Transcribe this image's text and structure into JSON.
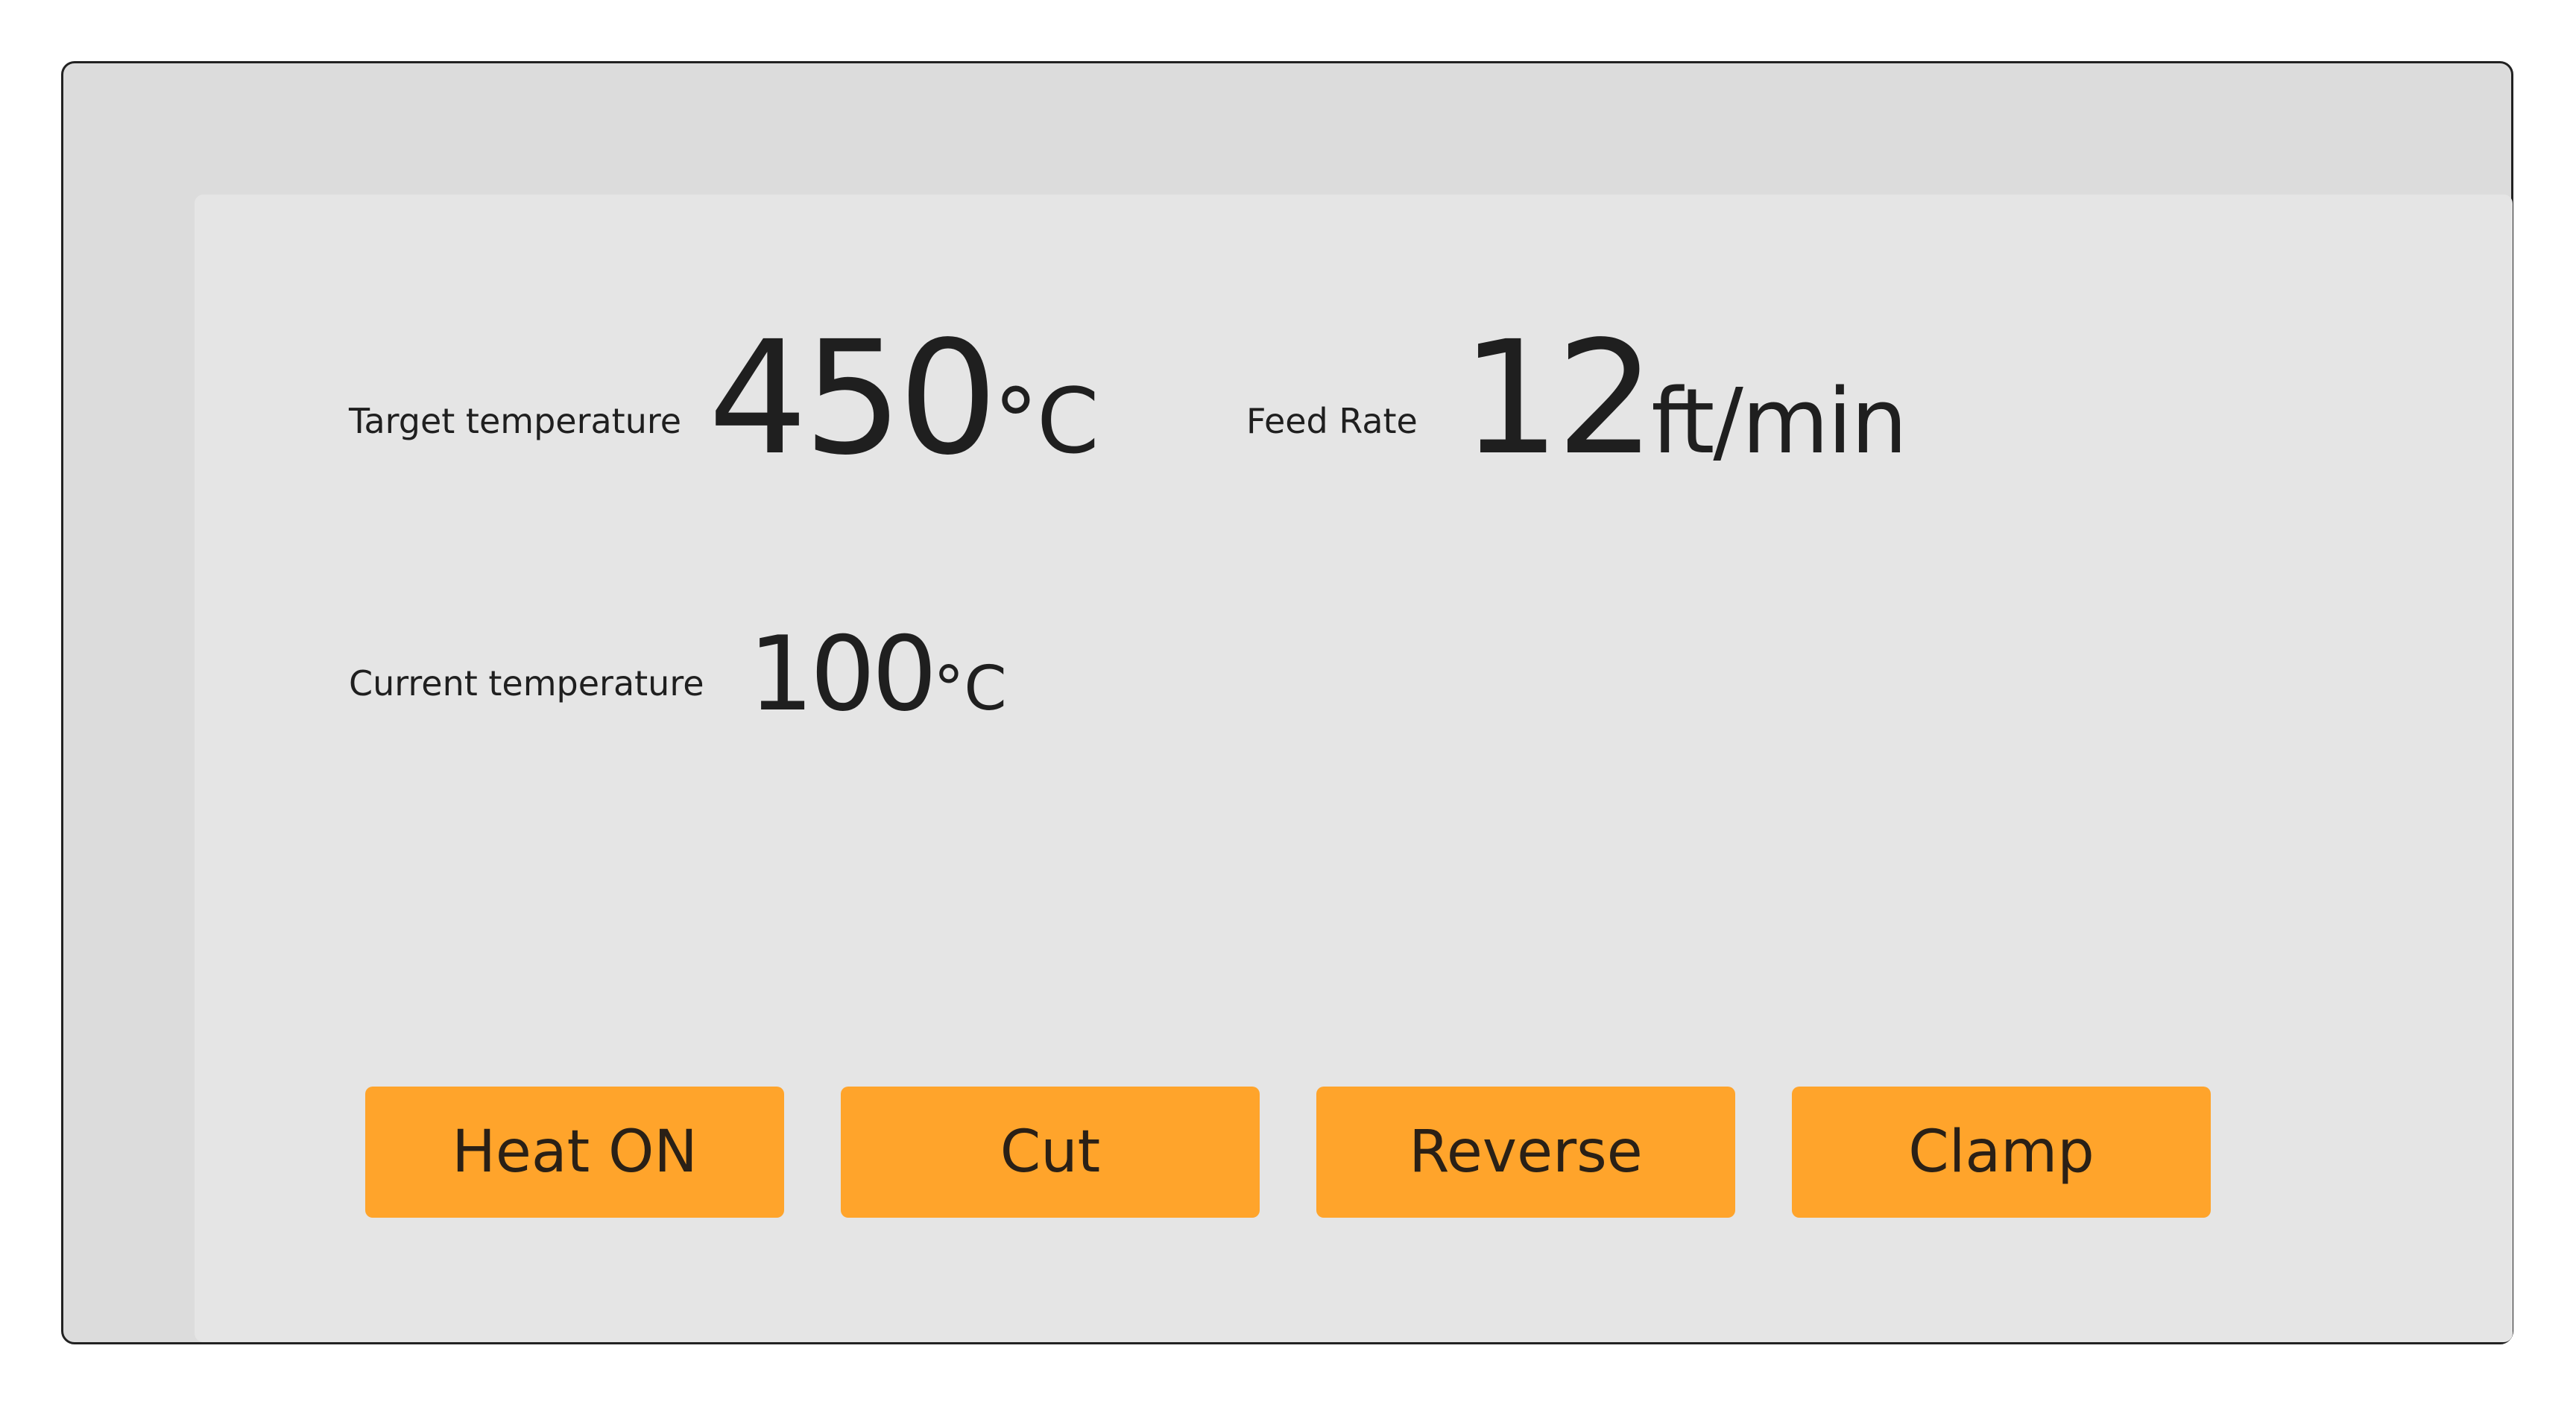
{
  "readouts": {
    "target_temperature": {
      "label": "Target temperature",
      "value": "450",
      "unit": "°C"
    },
    "feed_rate": {
      "label": "Feed Rate",
      "value": "12",
      "unit": "ft/min"
    },
    "current_temperature": {
      "label": "Current temperature",
      "value": "100",
      "unit": "°C"
    }
  },
  "buttons": {
    "heat": "Heat ON",
    "cut": "Cut",
    "reverse": "Reverse",
    "clamp": "Clamp"
  },
  "colors": {
    "button_accent": "#ffa42b",
    "panel_bg": "#dcdcdc",
    "screen_bg": "#e5e5e5",
    "text": "#1f1f1f"
  }
}
